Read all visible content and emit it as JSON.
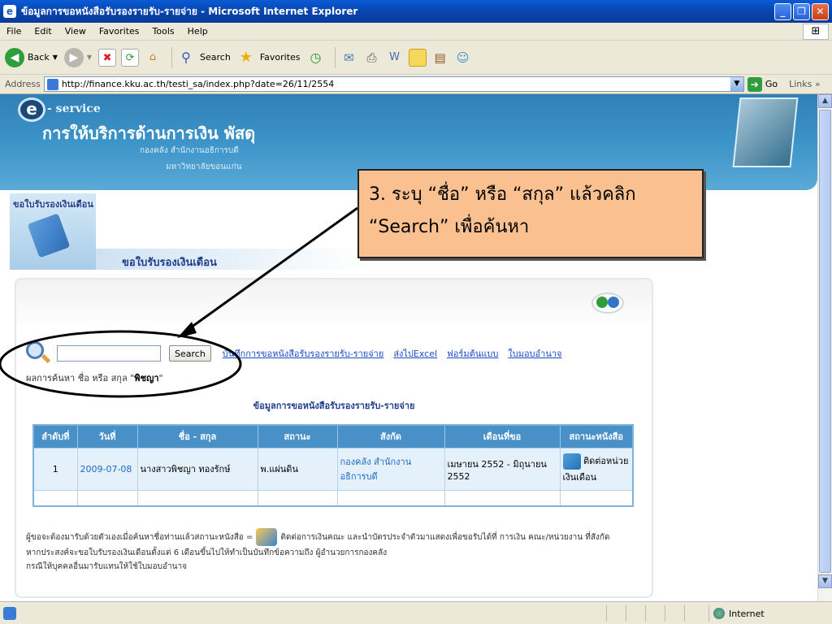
{
  "window": {
    "title": "ข้อมูลการขอหนังสือรับรองรายรับ-รายจ่าย - Microsoft Internet Explorer",
    "minimize": "_",
    "maximize": "❐",
    "close": "✕"
  },
  "menu": [
    "File",
    "Edit",
    "View",
    "Favorites",
    "Tools",
    "Help"
  ],
  "toolbar": {
    "back_label": "Back",
    "search_label": "Search",
    "favorites_label": "Favorites"
  },
  "address": {
    "label": "Address",
    "url": "http://finance.kku.ac.th/testi_sa/index.php?date=26/11/2554",
    "go_label": "Go",
    "links_label": "Links"
  },
  "banner": {
    "service": "- service",
    "main_title": "การให้บริการด้านการเงิน พัสดุ",
    "sub1": "กองคลัง สำนักงานอธิการบดี",
    "sub2": "มหาวิทยาลัยขอนแก่น"
  },
  "section": {
    "image_label": "ขอใบรับรองเงินเดือน",
    "title": "ขอใบรับรองเงินเดือน"
  },
  "search": {
    "input_value": "",
    "button_label": "Search",
    "links": [
      "บันทึกการขอหนังสือรับรองรายรับ-รายจ่าย",
      "ส่งไปExcel",
      "ฟอร์มต้นแบบ",
      "ใบมอบอำนาจ"
    ]
  },
  "result": {
    "prefix": "ผลการค้นหา ชื่อ หรือ สกุล \"",
    "term": "พิชญา",
    "suffix": "\""
  },
  "table": {
    "title": "ข้อมูลการขอหนังสือรับรองรายรับ-รายจ่าย",
    "headers": [
      "ลำดับที่",
      "วันที่",
      "ชื่อ - สกุล",
      "สถานะ",
      "สังกัด",
      "เดือนที่ขอ",
      "สถานะหนังสือ"
    ],
    "rows": [
      {
        "no": "1",
        "date": "2009-07-08",
        "name": "นางสาวพิชญา ทองรักษ์",
        "status": "พ.แผ่นดิน",
        "affiliation": "กองคลัง สำนักงานอธิการบดี",
        "month": "เมษายน 2552 - มิถุนายน 2552",
        "doc_status": "ติดต่อหน่วยเงินเดือน"
      }
    ]
  },
  "notes": {
    "line1_a": "ผู้ขอจะต้องมารับด้วยตัวเองเมื่อค้นหาชื่อท่านแล้วสถานะหนังสือ =",
    "line1_b": "ติดต่อการเงินคณะ และนำบัตรประจำตัวมาแสดงเพื่อขอรับได้ที่ การเงิน คณะ/หน่วยงาน ที่สังกัด",
    "line2": "หากประสงค์จะขอใบรับรองเงินเดือนตั้งแต่ 6 เดือนขึ้นไปให้ทำเป็นบันทึกข้อความถึง ผู้อำนวยการกองคลัง",
    "line3": "กรณีให้บุคคลอื่นมารับแทนให้ใช้ใบมอบอำนาจ"
  },
  "callout": {
    "line1": "3. ระบุ “ชื่อ” หรือ “สกุล” แล้วคลิก",
    "line2": "“Search” เพื่อค้นหา"
  },
  "status": {
    "zone": "Internet"
  },
  "colors": {
    "title_bar": "#0842a8",
    "banner": "#3c94c8",
    "table_header": "#4a90c8",
    "callout_fill": "#fac090",
    "link": "#1b4ac8"
  }
}
